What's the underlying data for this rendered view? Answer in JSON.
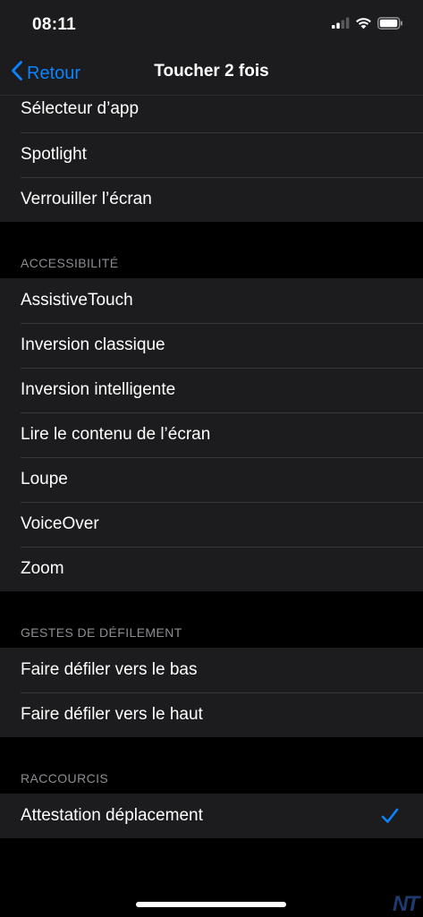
{
  "status_bar": {
    "time": "08:11"
  },
  "nav": {
    "back_label": "Retour",
    "title": "Toucher 2 fois"
  },
  "top_group": {
    "items": [
      {
        "label": "Sélecteur d’app"
      },
      {
        "label": "Spotlight"
      },
      {
        "label": "Verrouiller l’écran"
      }
    ]
  },
  "accessibility": {
    "header": "ACCESSIBILITÉ",
    "items": [
      {
        "label": "AssistiveTouch"
      },
      {
        "label": "Inversion classique"
      },
      {
        "label": "Inversion intelligente"
      },
      {
        "label": "Lire le contenu de l’écran"
      },
      {
        "label": "Loupe"
      },
      {
        "label": "VoiceOver"
      },
      {
        "label": "Zoom"
      }
    ]
  },
  "scroll_gestures": {
    "header": "GESTES DE DÉFILEMENT",
    "items": [
      {
        "label": "Faire défiler vers le bas"
      },
      {
        "label": "Faire défiler vers le haut"
      }
    ]
  },
  "shortcuts": {
    "header": "RACCOURCIS",
    "items": [
      {
        "label": "Attestation déplacement",
        "selected": true
      }
    ]
  },
  "watermark": "NT",
  "colors": {
    "accent": "#0a84ff",
    "background": "#000000",
    "cell_background": "#1c1c1e",
    "separator": "#38383a",
    "section_header": "#8d8d93"
  },
  "icons": {
    "back": "chevron-left-icon",
    "selected": "checkmark-icon",
    "signal": "cellular-signal-icon",
    "wifi": "wifi-icon",
    "battery": "battery-icon"
  }
}
